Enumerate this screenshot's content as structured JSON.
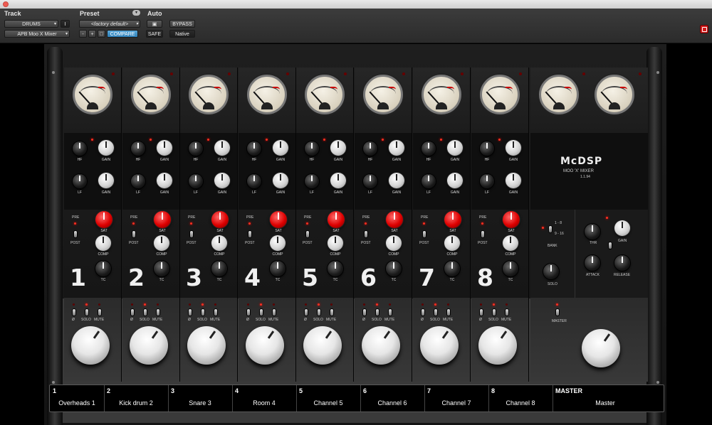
{
  "host": {
    "track_label": "Track",
    "preset_label": "Preset",
    "auto_label": "Auto",
    "track_name": "DRUMS",
    "track_insert": "I",
    "plugin_name": "APB Moo X Mixer",
    "preset_name": "<factory default>",
    "minus_label": "-",
    "plus_label": "+",
    "compare_label": "COMPARE",
    "bypass_label": "BYPASS",
    "safe_label": "SAFE",
    "native_label": "Native"
  },
  "brand": {
    "logo": "McDSP",
    "product": "MOO 'X' MIXER",
    "version": "1.1.94"
  },
  "labels": {
    "hf": "HF",
    "lf": "LF",
    "gain": "GAIN",
    "pre": "PRE",
    "post": "POST",
    "sat": "SAT",
    "comp": "COMP",
    "tc": "TC",
    "solo": "SOLO",
    "mute": "MUTE",
    "bank": "BANK",
    "bank_a": "1 - 8",
    "bank_b": "9 - 16",
    "solo_master": "SOLO",
    "thr": "THR",
    "gain_master": "GAIN",
    "attack": "ATTACK",
    "release": "RELEASE",
    "master_btn": "MASTER"
  },
  "channels": [
    {
      "num": "1",
      "name": "Overheads 1"
    },
    {
      "num": "2",
      "name": "Kick drum 2"
    },
    {
      "num": "3",
      "name": "Snare 3"
    },
    {
      "num": "4",
      "name": "Room 4"
    },
    {
      "num": "5",
      "name": "Channel 5"
    },
    {
      "num": "6",
      "name": "Channel 6"
    },
    {
      "num": "7",
      "name": "Channel 7"
    },
    {
      "num": "8",
      "name": "Channel 8"
    }
  ],
  "master": {
    "num": "MASTER",
    "name": "Master"
  },
  "colors": {
    "accent_red": "#d00000",
    "compare_blue": "#2c7fb8",
    "panel": "#161616"
  }
}
